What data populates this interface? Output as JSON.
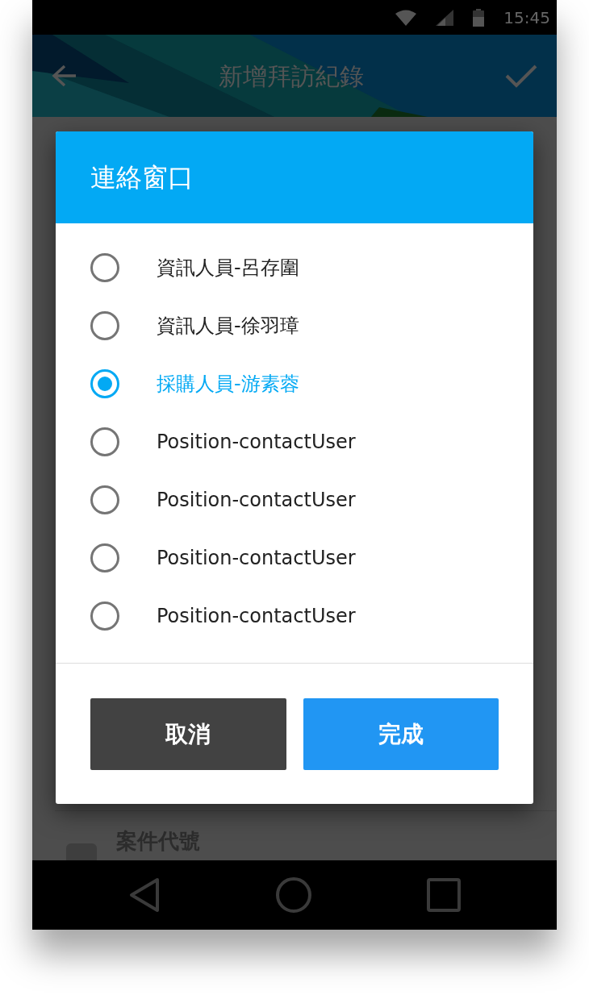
{
  "status_bar": {
    "time": "15:45"
  },
  "app_bar": {
    "title": "新增拜訪紀錄"
  },
  "background": {
    "field_label": "案件代號"
  },
  "dialog": {
    "title": "連絡窗口",
    "options": [
      {
        "label": "資訊人員-呂存圍",
        "selected": false
      },
      {
        "label": "資訊人員-徐羽璋",
        "selected": false
      },
      {
        "label": "採購人員-游素蓉",
        "selected": true
      },
      {
        "label": "Position-contactUser",
        "selected": false
      },
      {
        "label": "Position-contactUser",
        "selected": false
      },
      {
        "label": "Position-contactUser",
        "selected": false
      },
      {
        "label": "Position-contactUser",
        "selected": false
      }
    ],
    "buttons": [
      {
        "label": "取消",
        "kind": "cancel"
      },
      {
        "label": "完成",
        "kind": "confirm"
      }
    ]
  }
}
